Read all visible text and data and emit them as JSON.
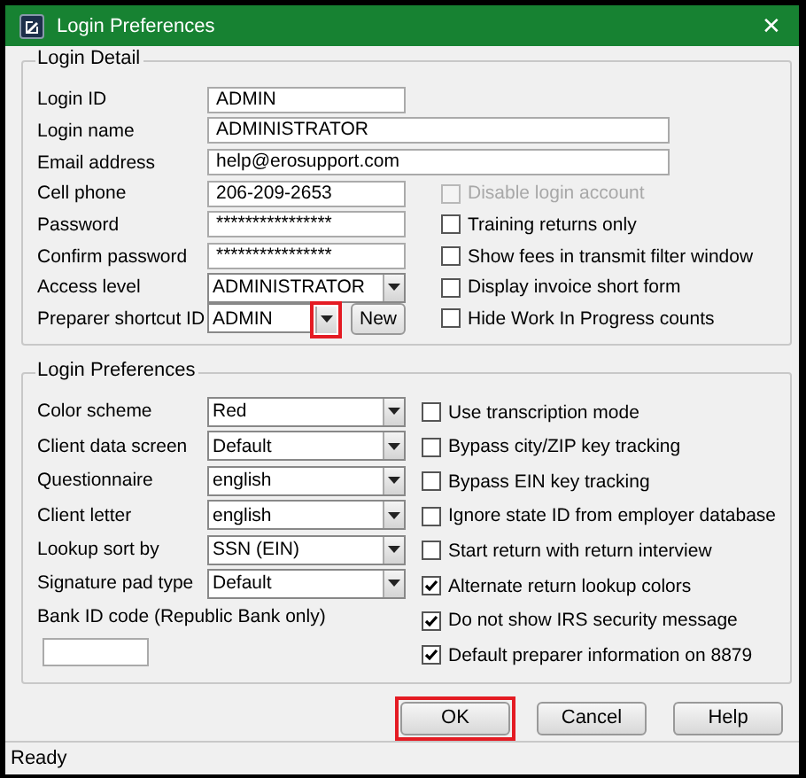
{
  "window": {
    "title": "Login Preferences",
    "close": "✕"
  },
  "login_detail": {
    "title": "Login Detail",
    "fields": [
      {
        "label": "Login ID",
        "kind": "text",
        "value": "ADMIN"
      },
      {
        "label": "Login name",
        "kind": "wide_text",
        "value": "ADMINISTRATOR"
      },
      {
        "label": "Email address",
        "kind": "wide_text",
        "value": "help@erosupport.com"
      },
      {
        "label": "Cell phone",
        "kind": "text",
        "value": "206-209-2653"
      },
      {
        "label": "Password",
        "kind": "text",
        "value": "****************"
      },
      {
        "label": "Confirm password",
        "kind": "text",
        "value": "****************"
      },
      {
        "label": "Access level",
        "kind": "combo",
        "value": "ADMINISTRATOR",
        "highlighted": false
      },
      {
        "label": "Preparer shortcut ID",
        "kind": "combo_new",
        "value": "ADMIN",
        "highlighted": true,
        "button": "New"
      }
    ],
    "checkboxes": [
      {
        "label": "Disable login account",
        "checked": false,
        "disabled": true
      },
      {
        "label": "Training returns only",
        "checked": false,
        "disabled": false
      },
      {
        "label": "Show fees in transmit filter window",
        "checked": false,
        "disabled": false
      },
      {
        "label": "Display invoice short form",
        "checked": false,
        "disabled": false
      },
      {
        "label": "Hide Work In Progress counts",
        "checked": false,
        "disabled": false
      }
    ]
  },
  "login_preferences": {
    "title": "Login Preferences",
    "fields": [
      {
        "label": "Color scheme",
        "value": "Red"
      },
      {
        "label": "Client data screen",
        "value": "Default"
      },
      {
        "label": "Questionnaire",
        "value": "english"
      },
      {
        "label": "Client letter",
        "value": "english"
      },
      {
        "label": "Lookup sort by",
        "value": "SSN (EIN)"
      },
      {
        "label": "Signature pad type",
        "value": "Default"
      }
    ],
    "bank_id": {
      "label": "Bank ID code (Republic Bank only)"
    },
    "checkboxes": [
      {
        "label": "Use transcription mode",
        "checked": false
      },
      {
        "label": "Bypass city/ZIP key tracking",
        "checked": false
      },
      {
        "label": "Bypass EIN key tracking",
        "checked": false
      },
      {
        "label": "Ignore state ID from employer database",
        "checked": false
      },
      {
        "label": "Start return with return interview",
        "checked": false
      },
      {
        "label": "Alternate return lookup colors",
        "checked": true
      },
      {
        "label": "Do not show IRS security message",
        "checked": true
      },
      {
        "label": "Default preparer information on 8879",
        "checked": true
      }
    ]
  },
  "buttons": [
    {
      "label": "OK",
      "highlighted": true
    },
    {
      "label": "Cancel",
      "highlighted": false
    },
    {
      "label": "Help",
      "highlighted": false
    }
  ],
  "status_bar": "Ready"
}
